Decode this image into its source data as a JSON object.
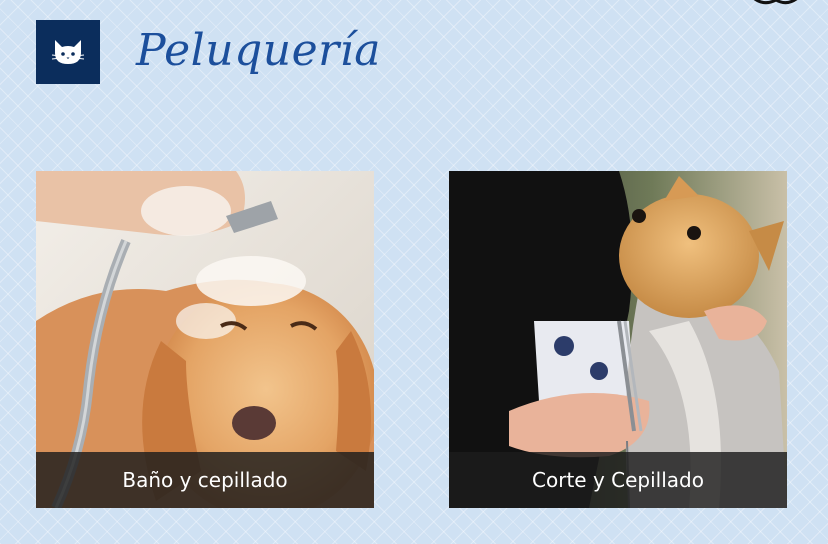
{
  "header": {
    "logo_icon": "cat-icon",
    "title": "Peluquería",
    "logo_color": "#0b2d5c",
    "title_color": "#1c4f9c"
  },
  "services": [
    {
      "caption": "Baño y cepillado",
      "photo": "dog-bath-photo"
    },
    {
      "caption": "Corte y Cepillado",
      "photo": "dog-grooming-photo"
    }
  ],
  "colors": {
    "background": "#cfe1f3",
    "caption_bg": "#1c1c1c"
  }
}
